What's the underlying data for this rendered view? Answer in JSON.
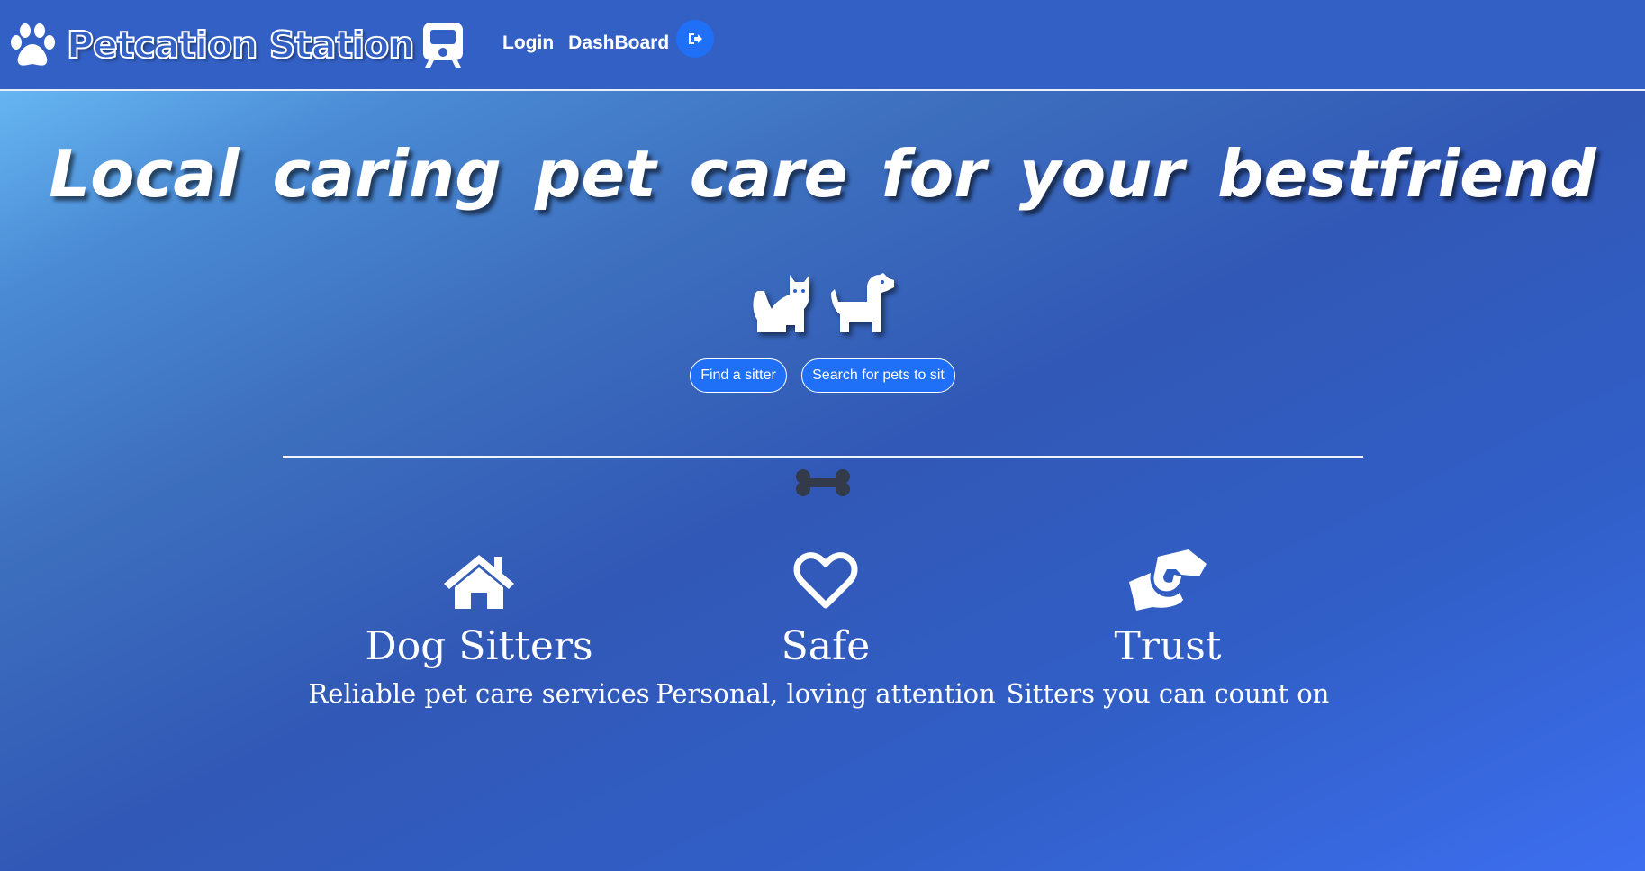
{
  "navbar": {
    "brand_name": "Petcation Station",
    "links": [
      {
        "label": "Login"
      },
      {
        "label": "DashBoard"
      }
    ],
    "logout_icon": "sign-out-icon",
    "accent_color": "#1f6ff7",
    "background_color": "#3360c4"
  },
  "hero": {
    "headline": "Local caring pet care for your bestfriend",
    "icons": [
      "cat-icon",
      "dog-icon"
    ],
    "buttons": {
      "find_sitter": "Find a sitter",
      "search_pets": "Search for pets to sit"
    },
    "divider_icon": "bone-icon"
  },
  "features": [
    {
      "icon": "house-icon",
      "title": "Dog Sitters",
      "subtitle": "Reliable pet care services"
    },
    {
      "icon": "heart-icon",
      "title": "Safe",
      "subtitle": "Personal, loving attention"
    },
    {
      "icon": "handshake-icon",
      "title": "Trust",
      "subtitle": "Sitters you can count on"
    }
  ]
}
